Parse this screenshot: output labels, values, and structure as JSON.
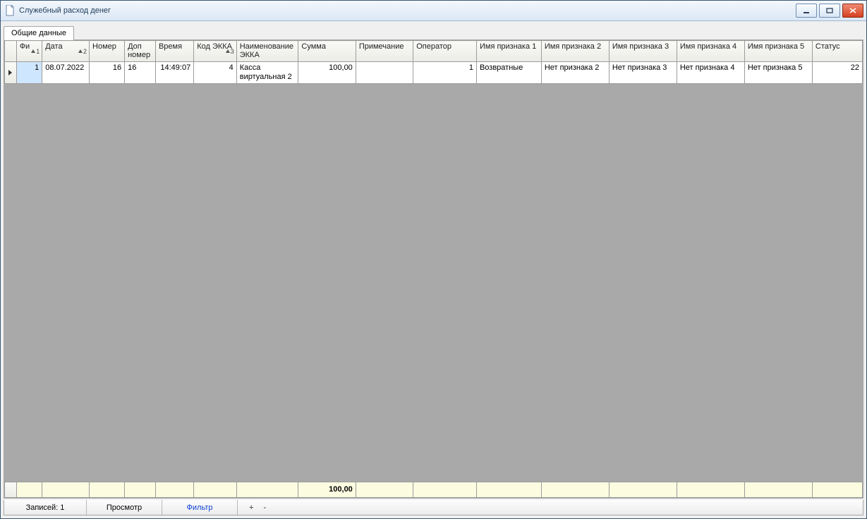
{
  "window": {
    "title": "Служебный расход денег"
  },
  "tabs": {
    "main": "Общие данные"
  },
  "columns": {
    "fi": {
      "label": "Фи",
      "sort": "1"
    },
    "date": {
      "label": "Дата",
      "sort": "2"
    },
    "number": {
      "label": "Номер"
    },
    "dopnum": {
      "label": "Доп номер"
    },
    "time": {
      "label": "Время"
    },
    "kodekka": {
      "label": "Код ЭККА",
      "sort": "3"
    },
    "nameekka": {
      "label": "Наименование ЭККА"
    },
    "sum": {
      "label": "Сумма"
    },
    "note": {
      "label": "Примечание"
    },
    "oper": {
      "label": "Оператор"
    },
    "attr1": {
      "label": "Имя признака 1"
    },
    "attr2": {
      "label": "Имя признака 2"
    },
    "attr3": {
      "label": "Имя признака 3"
    },
    "attr4": {
      "label": "Имя признака 4"
    },
    "attr5": {
      "label": "Имя признака 5"
    },
    "status": {
      "label": "Статус"
    }
  },
  "row": {
    "fi": "1",
    "date": "08.07.2022",
    "number": "16",
    "dopnum": "16",
    "time": "14:49:07",
    "kodekka": "4",
    "nameekka": "Касса виртуальная 2",
    "sum": "100,00",
    "note": "",
    "oper": "1",
    "attr1": "Возвратные",
    "attr2": "Нет признака 2",
    "attr3": "Нет признака 3",
    "attr4": "Нет признака 4",
    "attr5": "Нет признака 5",
    "status": "22"
  },
  "totals": {
    "sum": "100,00"
  },
  "status": {
    "records": "Записей: 1",
    "view": "Просмотр",
    "filter": "Фильтр",
    "plus": "+",
    "minus": "-"
  }
}
